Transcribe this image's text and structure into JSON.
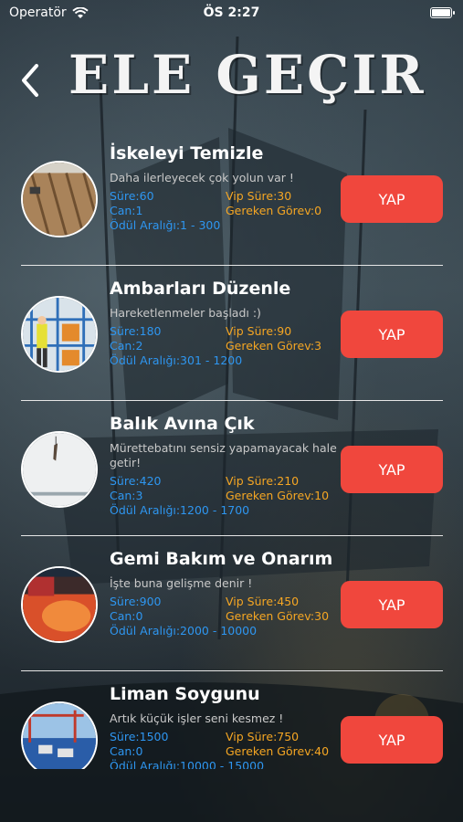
{
  "status_bar": {
    "carrier": "Operatör",
    "time": "ÖS 2:27"
  },
  "header": {
    "title": "ELE GEÇIR"
  },
  "tasks": [
    {
      "title": "İskeleyi Temizle",
      "description": "Daha ilerleyecek çok yolun var !",
      "sure": "Süre:60",
      "can": "Can:1",
      "odul": "Ödül Aralığı:1 - 300",
      "vip_sure": "Vip Süre:30",
      "gereken": "Gereken Görev:0",
      "button": "YAP"
    },
    {
      "title": "Ambarları Düzenle",
      "description": "Hareketlenmeler başladı :)",
      "sure": "Süre:180",
      "can": "Can:2",
      "odul": "Ödül Aralığı:301 - 1200",
      "vip_sure": "Vip Süre:90",
      "gereken": "Gereken Görev:3",
      "button": "YAP"
    },
    {
      "title": "Balık Avına Çık",
      "description": "Mürettebatını sensiz yapamayacak hale getir!",
      "sure": "Süre:420",
      "can": "Can:3",
      "odul": "Ödül Aralığı:1200 - 1700",
      "vip_sure": "Vip Süre:210",
      "gereken": "Gereken Görev:10",
      "button": "YAP"
    },
    {
      "title": "Gemi Bakım ve Onarım",
      "description": "İşte buna gelişme denir !",
      "sure": "Süre:900",
      "can": "Can:0",
      "odul": "Ödül Aralığı:2000 - 10000",
      "vip_sure": "Vip Süre:450",
      "gereken": "Gereken Görev:30",
      "button": "YAP"
    },
    {
      "title": "Liman Soygunu",
      "description": "Artık küçük işler seni kesmez !",
      "sure": "Süre:1500",
      "can": "Can:0",
      "odul": "Ödül Aralığı:10000 - 15000",
      "vip_sure": "Vip Süre:750",
      "gereken": "Gereken Görev:40",
      "button": "YAP"
    }
  ]
}
